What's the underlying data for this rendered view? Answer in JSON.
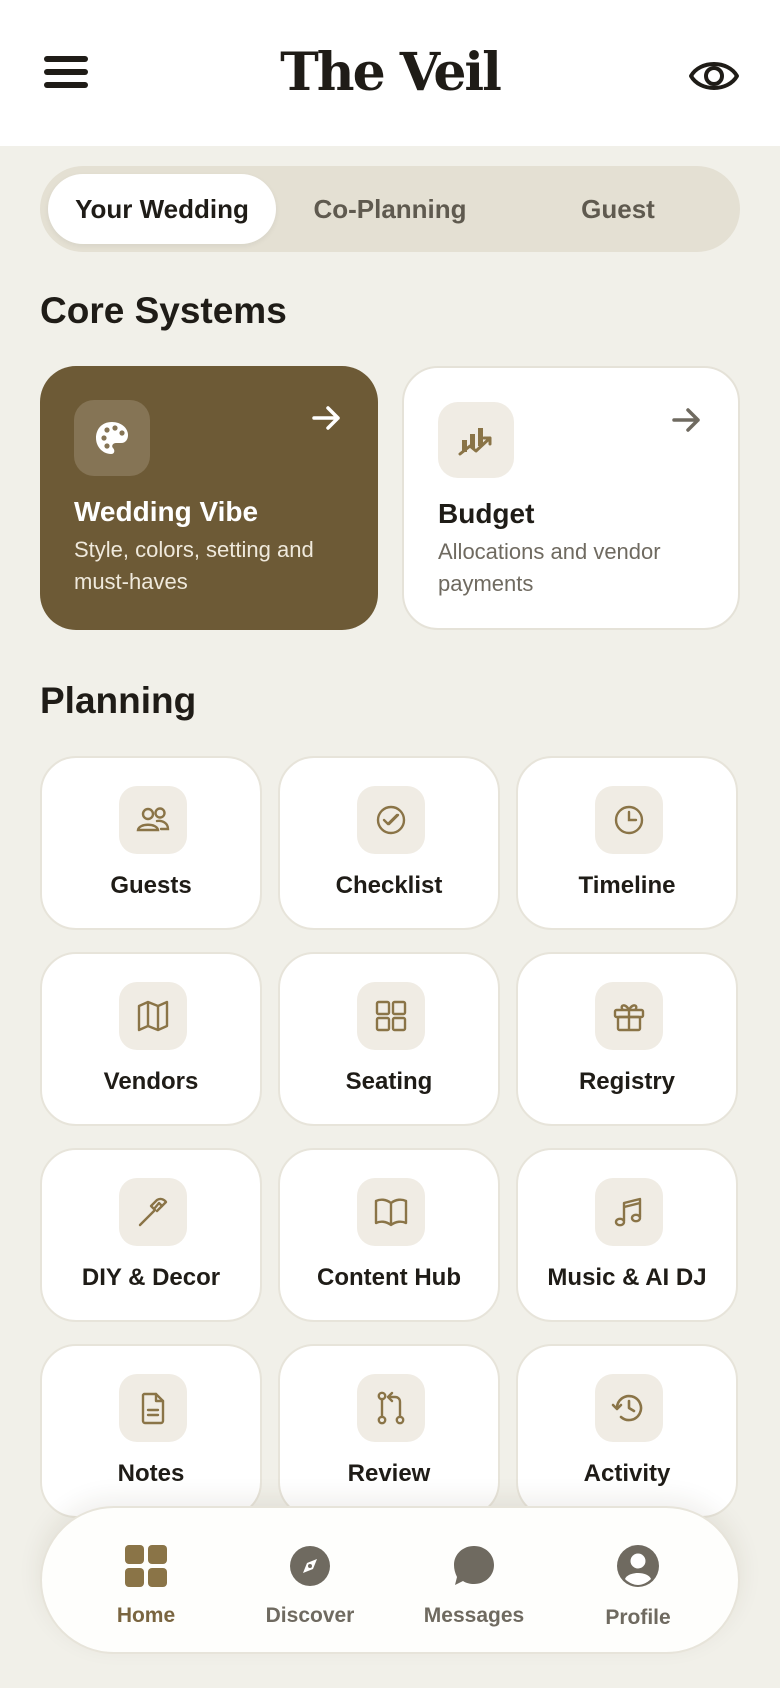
{
  "header": {
    "title": "The Veil",
    "menu_icon": "hamburger-menu-icon",
    "visibility_icon": "eye-icon"
  },
  "tabs": [
    {
      "label": "Your Wedding",
      "active": true
    },
    {
      "label": "Co-Planning",
      "active": false
    },
    {
      "label": "Guest",
      "active": false
    }
  ],
  "core": {
    "title": "Core Systems",
    "cards": [
      {
        "title": "Wedding Vibe",
        "description": "Style, colors, setting and must-haves",
        "icon": "palette-icon",
        "style": "dark"
      },
      {
        "title": "Budget",
        "description": "Allocations and vendor payments",
        "icon": "chart-trend-icon",
        "style": "light"
      }
    ]
  },
  "planning": {
    "title": "Planning",
    "tiles": [
      {
        "label": "Guests",
        "icon": "people-icon"
      },
      {
        "label": "Checklist",
        "icon": "check-circle-icon"
      },
      {
        "label": "Timeline",
        "icon": "clock-icon"
      },
      {
        "label": "Vendors",
        "icon": "map-icon"
      },
      {
        "label": "Seating",
        "icon": "grid-icon"
      },
      {
        "label": "Registry",
        "icon": "gift-icon"
      },
      {
        "label": "DIY & Decor",
        "icon": "hammer-icon"
      },
      {
        "label": "Content Hub",
        "icon": "book-icon"
      },
      {
        "label": "Music & AI DJ",
        "icon": "music-icon"
      },
      {
        "label": "Notes",
        "icon": "document-icon"
      },
      {
        "label": "Review",
        "icon": "pull-request-icon"
      },
      {
        "label": "Activity",
        "icon": "history-icon"
      }
    ]
  },
  "bottom_nav": [
    {
      "label": "Home",
      "icon": "home-grid-icon",
      "active": true
    },
    {
      "label": "Discover",
      "icon": "compass-icon",
      "active": false
    },
    {
      "label": "Messages",
      "icon": "chat-bubble-icon",
      "active": false
    },
    {
      "label": "Profile",
      "icon": "profile-icon",
      "active": false
    }
  ],
  "colors": {
    "background": "#f1f0e9",
    "accent_brown": "#6d5a36",
    "icon_brown": "#8a7447",
    "tab_track": "#e4e0d3",
    "text_dark": "#1f1c17"
  }
}
